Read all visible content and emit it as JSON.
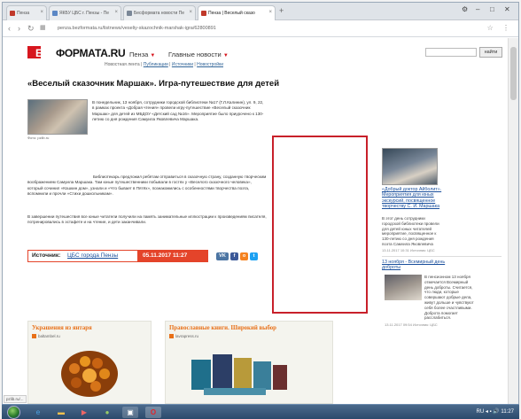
{
  "browser": {
    "tabs": [
      {
        "label": "Пенза",
        "fav_color": "#c0392b"
      },
      {
        "label": "ЯКБУ ЦБС г. Пензы - Пе",
        "fav_color": "#5b87c5"
      },
      {
        "label": "Бесформата новости Пе",
        "fav_color": "#7a8797"
      },
      {
        "label": "Пенза | Веселый сказо",
        "fav_color": "#c0392b"
      }
    ],
    "url": "penza.bezformata.ru/listnews/veseliy-skazochnik-marshak-igra/62800891",
    "win_controls": [
      "⚙",
      "–",
      "□",
      "✕"
    ]
  },
  "site": {
    "logo_a": "БЕЗ",
    "logo_b": "ФОРМАТА.RU",
    "nav_city": "Пенза",
    "nav_main": "Главные новости",
    "subnav_prefix": "Новостная лента",
    "subnav_items": [
      "Публикации",
      "Источники",
      "Новостройки"
    ],
    "search_placeholder": "",
    "search_button": "найти"
  },
  "article": {
    "title": "«Веселый сказочник Маршак». Игра-путешествие для детей",
    "photo_caption": "Фото: pzlib.ru",
    "p1": "В понедельник, 13 ноября, сотрудники городской библиотеки №17 (Г.Л.Калинин), ул. 9, 22, в рамках проекта «Добрая чтения» провели игру-путешествие «Веселый сказочник Маршак» для детей из МБДОУ «Детский сад №16». Мероприятие было приурочено к 130-летию со дня рождения Самуила Яковлевича Маршака.",
    "p2": "Библиотекарь предложил ребятам отправиться в сказочную страну, созданную творческим воображением Самуила Маршака. Там юные путешественники побывали в гостях у «Веселого сказочного человека», который сочинил «Кошкин дом», узнали и «Что бывает в Пятёх», познакомились с особенностями творчества поэта, вспомнили и прочли «Стихи дошкольникам».",
    "p3": "В завершении путешествия все юные читатели получили на память занимательные иллюстрации к произведениям писателя, потренировались в эстафете и на чтение, и дети заканчивали.",
    "source_label": "Источник:",
    "source_name": "ЦБС города Пензы",
    "source_date": "05.11.2017  11:27"
  },
  "share": [
    {
      "label": "VK",
      "color": "#4c75a3"
    },
    {
      "label": "f",
      "color": "#3b5998"
    },
    {
      "label": "o",
      "color": "#f58220"
    },
    {
      "label": "t",
      "color": "#1da1f2"
    }
  ],
  "sidebar": {
    "item1_title": "«Добрый доктор Айболит». Мероприятия для юных экскурсий, посвященное творчеству С. И. Маршака",
    "item1_text": "В этот день сотрудники городской библиотеки провели для детей юных читателей мероприятие, посвященное к 130-летию со дня рождения поэта Самуила Яковлевича Маршака.",
    "item1_date": "13.11.2017 10:31  Источник: ЦБС",
    "item2_title": "13 ноября - Всемирный день доброты",
    "item2_text": "В пенсионном 13 ноября отмечается Всемирный день доброты. Считается, что люди, которые совершают добрые дела, живут дольше и чувствуют себя более счастливыми. Доброта помогает расслабиться.",
    "item2_date": "13.11.2017 09:54  Источник: ЦБС"
  },
  "cards": [
    {
      "title": "Украшения из янтаря",
      "sub": "baltambel.ru"
    },
    {
      "title": "Православные книги. Широкий выбор",
      "sub": "lavrapress.ru"
    }
  ],
  "status_url": "pzlib.ru/...",
  "taskbar": {
    "tray": "RU  ◂ ▪ 🔊  11:27"
  }
}
